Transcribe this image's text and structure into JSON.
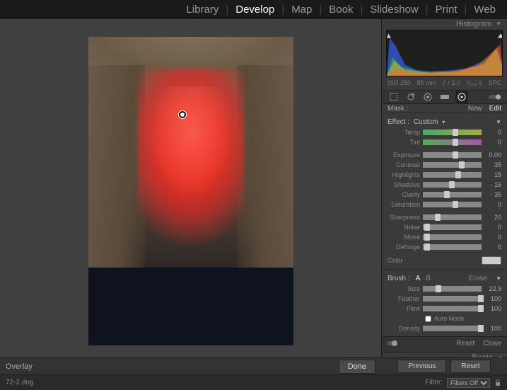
{
  "nav": {
    "library": "Library",
    "develop": "Develop",
    "map": "Map",
    "book": "Book",
    "slideshow": "Slideshow",
    "print": "Print",
    "web": "Web"
  },
  "histogram": {
    "title": "Histogram",
    "iso": "ISO 250",
    "focal": "85 mm",
    "aperture": "ƒ / 2.0",
    "shutter": "¹⁄₂₅₀ s",
    "spc": "SPC"
  },
  "mask": {
    "label": "Mask :",
    "new": "New",
    "edit": "Edit"
  },
  "effect": {
    "label": "Effect :",
    "preset": "Custom"
  },
  "sliders": {
    "temp": {
      "label": "Temp",
      "value": "0",
      "pos": 50
    },
    "tint": {
      "label": "Tint",
      "value": "0",
      "pos": 50
    },
    "exposure": {
      "label": "Exposure",
      "value": "0.00",
      "pos": 50
    },
    "contrast": {
      "label": "Contrast",
      "value": "35",
      "pos": 62
    },
    "highlights": {
      "label": "Highlights",
      "value": "15",
      "pos": 56
    },
    "shadows": {
      "label": "Shadows",
      "value": "- 15",
      "pos": 44
    },
    "clarity": {
      "label": "Clarity",
      "value": "- 35",
      "pos": 36
    },
    "saturation": {
      "label": "Saturation",
      "value": "0",
      "pos": 50
    },
    "sharpness": {
      "label": "Sharpness",
      "value": "20",
      "pos": 20
    },
    "noise": {
      "label": "Noise",
      "value": "0",
      "pos": 2
    },
    "moire": {
      "label": "Moiré",
      "value": "0",
      "pos": 2
    },
    "defringe": {
      "label": "Defringe",
      "value": "0",
      "pos": 2
    }
  },
  "color": {
    "label": "Color"
  },
  "brush": {
    "label": "Brush :",
    "a": "A",
    "b": "B",
    "erase": "Erase",
    "size": {
      "label": "Size",
      "value": "22.9",
      "pos": 22
    },
    "feather": {
      "label": "Feather",
      "value": "100",
      "pos": 100
    },
    "flow": {
      "label": "Flow",
      "value": "100",
      "pos": 100
    },
    "automask": "Auto Mask",
    "density": {
      "label": "Density",
      "value": "100",
      "pos": 100
    }
  },
  "footer": {
    "reset": "Reset",
    "close": "Close",
    "basic": "Basic"
  },
  "canvas": {
    "overlay": "Overlay",
    "done": "Done"
  },
  "nav2": {
    "prev": "Previous",
    "reset": "Reset"
  },
  "file": {
    "name": "72-2.dng",
    "filter": "Filter:",
    "filters_off": "Filters Off"
  }
}
